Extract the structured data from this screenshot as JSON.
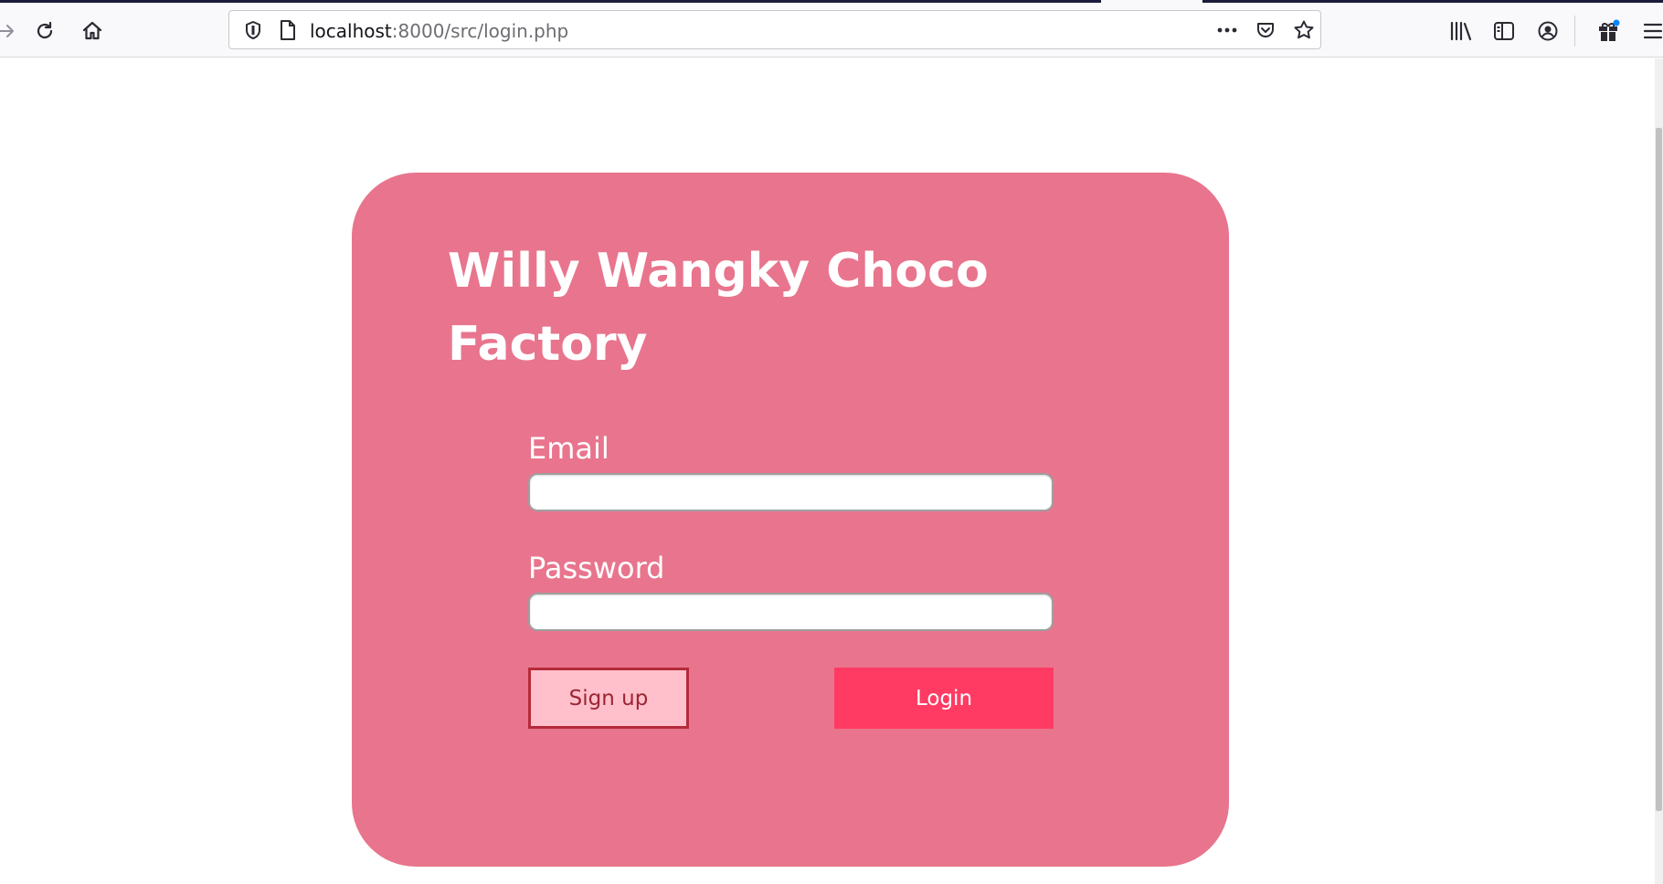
{
  "browser": {
    "url_host": "localhost",
    "url_rest": ":8000/src/login.php",
    "icons": {
      "forward": "forward-arrow-icon",
      "reload": "reload-icon",
      "home": "home-icon",
      "tracking": "tracking-protection-shield-icon",
      "page": "page-info-icon",
      "page_actions": "more-actions-icon",
      "pocket": "pocket-icon",
      "bookmark": "bookmark-star-icon",
      "library": "library-icon",
      "sidebar": "sidebar-icon",
      "account": "account-icon",
      "extension": "gift-extension-icon",
      "menu": "hamburger-menu-icon"
    }
  },
  "page": {
    "title": "Willy Wangky Choco Factory",
    "email_label": "Email",
    "email_value": "",
    "password_label": "Password",
    "password_value": "",
    "signup_label": "Sign up",
    "login_label": "Login"
  },
  "colors": {
    "card": "#e8758d",
    "signup_bg": "#ffc0cb",
    "signup_border": "#b52a3a",
    "login_bg": "#ff3b63",
    "text": "#ffffff"
  }
}
